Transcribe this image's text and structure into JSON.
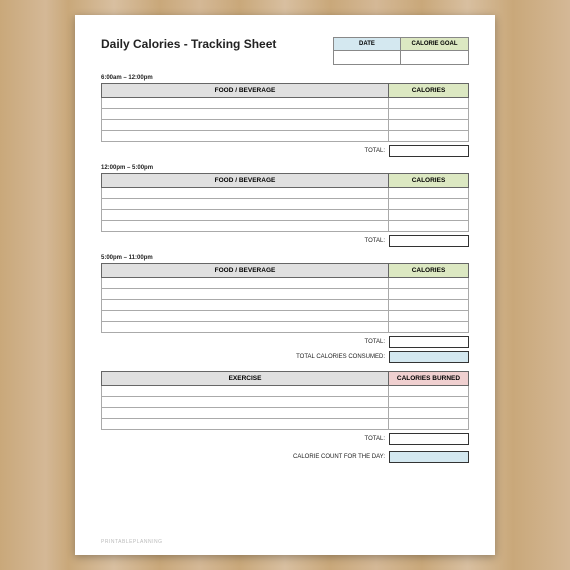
{
  "title": "Daily Calories - Tracking Sheet",
  "header": {
    "date_label": "DATE",
    "goal_label": "CALORIE GOAL"
  },
  "sections": [
    {
      "time": "6:00am – 12:00pm",
      "food_header": "FOOD / BEVERAGE",
      "cal_header": "CALORIES",
      "rows": 4,
      "total_label": "TOTAL:"
    },
    {
      "time": "12:00pm – 5:00pm",
      "food_header": "FOOD / BEVERAGE",
      "cal_header": "CALORIES",
      "rows": 4,
      "total_label": "TOTAL:"
    },
    {
      "time": "5:00pm – 11:00pm",
      "food_header": "FOOD / BEVERAGE",
      "cal_header": "CALORIES",
      "rows": 5,
      "total_label": "TOTAL:"
    }
  ],
  "consumed_label": "TOTAL CALORIES CONSUMED:",
  "exercise": {
    "header_left": "EXERCISE",
    "header_right": "CALORIES BURNED",
    "rows": 4,
    "total_label": "TOTAL:"
  },
  "day_count_label": "CALORIE COUNT FOR THE DAY:",
  "brand": "PRINTABLEPLANNING"
}
